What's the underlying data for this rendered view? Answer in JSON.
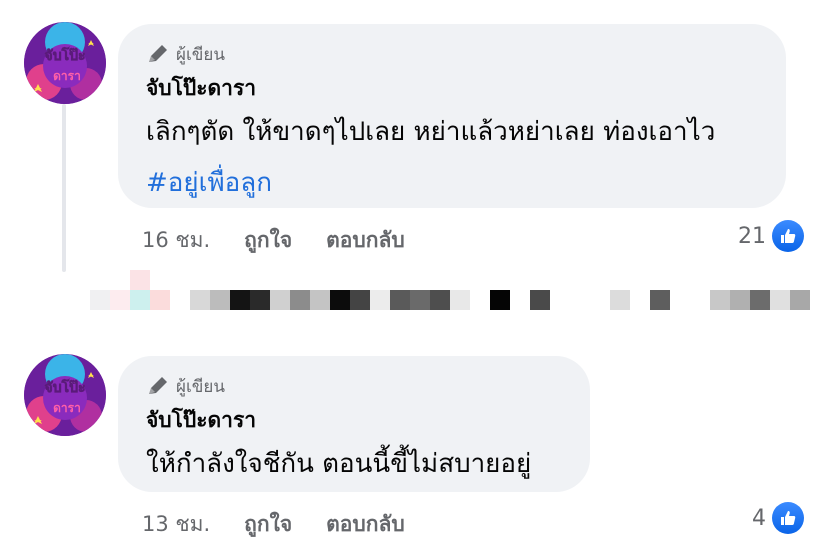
{
  "comments": [
    {
      "badge": "ผู้เขียน",
      "author": "จับโป๊ะดารา",
      "text": "เลิกๆตัด ให้ขาดๆไปเลย หย่าแล้วหย่าเลย ท่องเอาไว",
      "hashtag": "#อยู่เพื่อลูก",
      "time": "16 ชม.",
      "like_label": "ถูกใจ",
      "reply_label": "ตอบกลับ",
      "reaction_count": "21"
    },
    {
      "badge": "ผู้เขียน",
      "author": "จับโป๊ะดารา",
      "text": "ให้กำลังใจชีกัน ตอนนี้ขี้ไม่สบายอยู่",
      "time": "13 ชม.",
      "like_label": "ถูกใจ",
      "reply_label": "ตอบกลับ",
      "reaction_count": "4"
    }
  ],
  "avatar_text": [
    "จับโป๊ะ",
    "ดารา"
  ],
  "colors": {
    "bubble": "#f0f2f5",
    "secondary_text": "#65676b",
    "hashtag": "#216fdb",
    "like_blue": "#1877f2",
    "avatar_bg": "#7b2fa8"
  },
  "icons": [
    "pencil-icon",
    "thumbs-up-icon"
  ]
}
